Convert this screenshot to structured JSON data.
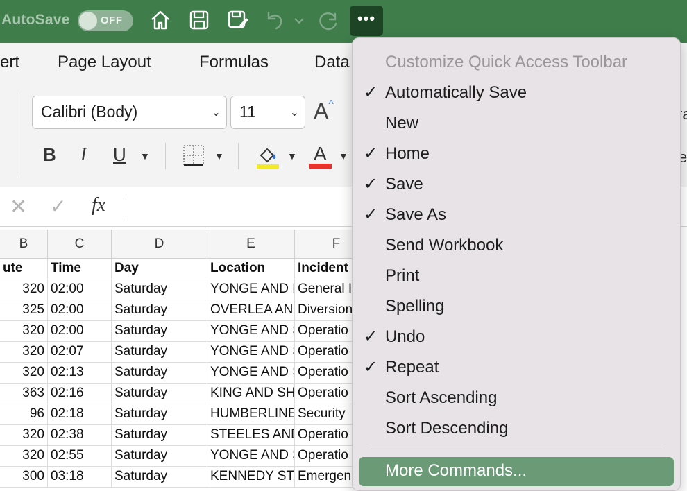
{
  "titlebar": {
    "autosave_label": "AutoSave",
    "autosave_state": "OFF",
    "more_label": "•••"
  },
  "ribbon": {
    "tabs": [
      "ert",
      "Page Layout",
      "Formulas",
      "Data"
    ],
    "font_name": "Calibri (Body)",
    "font_size": "11",
    "bold": "B",
    "italic": "I",
    "underline": "U",
    "font_color": "A",
    "grow_font": "A",
    "right_clip_1": "ra",
    "right_clip_2": "e"
  },
  "formula_bar": {
    "fx": "fx"
  },
  "grid": {
    "columns": [
      "B",
      "C",
      "D",
      "E",
      "F"
    ],
    "headers": [
      "ute",
      "Time",
      "Day",
      "Location",
      "Incident"
    ],
    "rows": [
      [
        "320",
        "02:00",
        "Saturday",
        "YONGE AND D",
        "General I"
      ],
      [
        "325",
        "02:00",
        "Saturday",
        "OVERLEA AND",
        "Diversion"
      ],
      [
        "320",
        "02:00",
        "Saturday",
        "YONGE AND S",
        "Operatio"
      ],
      [
        "320",
        "02:07",
        "Saturday",
        "YONGE AND S",
        "Operatio"
      ],
      [
        "320",
        "02:13",
        "Saturday",
        "YONGE AND S",
        "Operatio"
      ],
      [
        "363",
        "02:16",
        "Saturday",
        "KING AND SH.",
        "Operatio"
      ],
      [
        "96",
        "02:18",
        "Saturday",
        "HUMBERLINE",
        "Security"
      ],
      [
        "320",
        "02:38",
        "Saturday",
        "STEELES AND",
        "Operatio"
      ],
      [
        "320",
        "02:55",
        "Saturday",
        "YONGE AND S",
        "Operatio"
      ],
      [
        "300",
        "03:18",
        "Saturday",
        "KENNEDY STA",
        "Emergen"
      ]
    ]
  },
  "menu": {
    "header": "Customize Quick Access Toolbar",
    "items": [
      {
        "label": "Automatically Save",
        "checked": "✓"
      },
      {
        "label": "New",
        "checked": ""
      },
      {
        "label": "Home",
        "checked": "✓"
      },
      {
        "label": "Save",
        "checked": "✓"
      },
      {
        "label": "Save As",
        "checked": "✓"
      },
      {
        "label": "Send Workbook",
        "checked": ""
      },
      {
        "label": "Print",
        "checked": ""
      },
      {
        "label": "Spelling",
        "checked": ""
      },
      {
        "label": "Undo",
        "checked": "✓"
      },
      {
        "label": "Repeat",
        "checked": "✓"
      },
      {
        "label": "Sort Ascending",
        "checked": ""
      },
      {
        "label": "Sort Descending",
        "checked": ""
      }
    ],
    "more_commands": "More Commands..."
  }
}
